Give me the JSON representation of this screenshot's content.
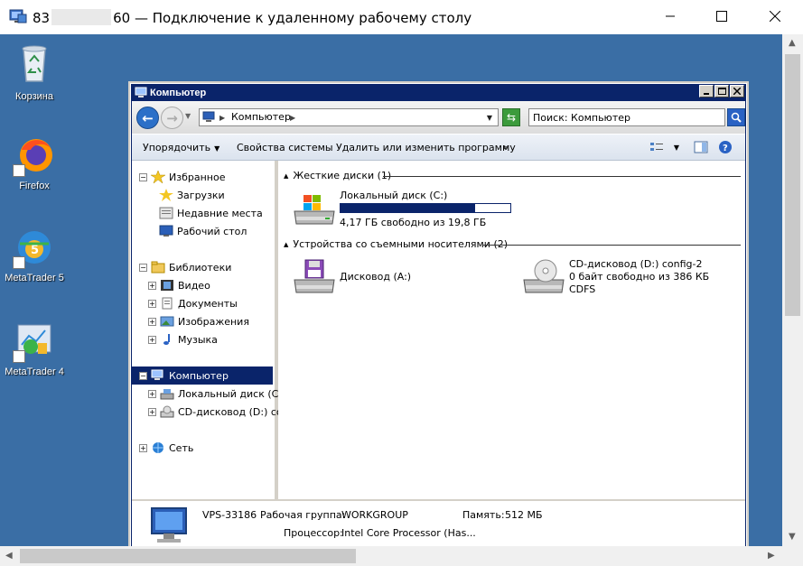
{
  "rdp": {
    "title_prefix": "83",
    "title_suffix": "60 — Подключение к удаленному рабочему столу"
  },
  "desktop": {
    "icons": [
      {
        "label": "Корзина",
        "icon": "recycle-bin-icon"
      },
      {
        "label": "Firefox",
        "icon": "firefox-icon"
      },
      {
        "label": "MetaTrader 5",
        "icon": "metatrader5-icon"
      },
      {
        "label": "MetaTrader 4",
        "icon": "metatrader4-icon"
      }
    ]
  },
  "explorer": {
    "title": "Компьютер",
    "address": "Компьютер",
    "search_placeholder": "Поиск: Компьютер",
    "commands": {
      "organize": "Упорядочить",
      "system_properties": "Свойства системы",
      "uninstall": "Удалить или изменить программу",
      "more": "»"
    },
    "nav": {
      "favorites": "Избранное",
      "downloads": "Загрузки",
      "recent": "Недавние места",
      "desktop": "Рабочий стол",
      "libraries": "Библиотеки",
      "video": "Видео",
      "documents": "Документы",
      "images": "Изображения",
      "music": "Музыка",
      "computer": "Компьютер",
      "local_disk": "Локальный диск (C:)",
      "cd_drive": "CD-дисковод (D:) cor",
      "network": "Сеть"
    },
    "groups": {
      "hard_disks": "Жесткие диски (1)",
      "removable": "Устройства со съемными носителями (2)"
    },
    "drives": {
      "local_c": {
        "name": "Локальный диск (C:)",
        "free": "4,17 ГБ свободно из 19,8 ГБ",
        "used_fraction": 0.79
      },
      "floppy_a": {
        "name": "Дисковод (A:)"
      },
      "cd_d": {
        "name": "CD-дисковод (D:) config-2",
        "free": "0 байт свободно из 386 КБ",
        "fs": "CDFS"
      }
    },
    "details": {
      "name": "VPS-33186",
      "workgroup_label": "Рабочая группа:",
      "workgroup": "WORKGROUP",
      "memory_label": "Память:",
      "memory": "512 МБ",
      "cpu_label": "Процессор:",
      "cpu": "Intel Core Processor (Has..."
    }
  },
  "colors": {
    "desktop": "#3a6ea5",
    "title_active": "#0a246a",
    "window_face": "#d4d0c8"
  }
}
